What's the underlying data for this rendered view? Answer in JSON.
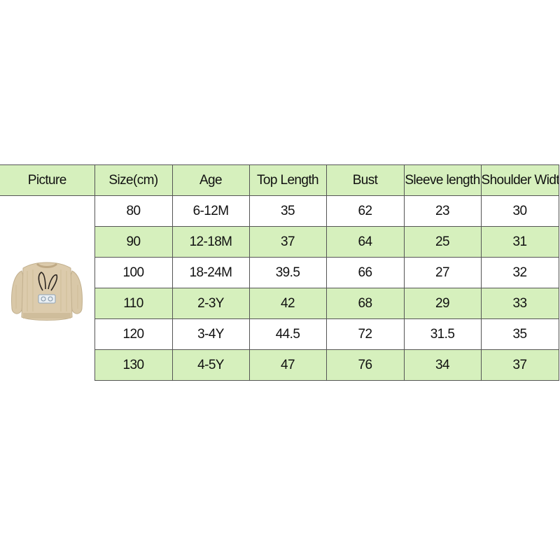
{
  "table": {
    "headers": [
      "Picture",
      "Size(cm)",
      "Age",
      "Top Length",
      "Bust",
      "Sleeve length",
      "Shoulder Width"
    ],
    "rows": [
      {
        "size": "80",
        "age": "6-12M",
        "top_length": "35",
        "bust": "62",
        "sleeve_length": "23",
        "shoulder_width": "30"
      },
      {
        "size": "90",
        "age": "12-18M",
        "top_length": "37",
        "bust": "64",
        "sleeve_length": "25",
        "shoulder_width": "31"
      },
      {
        "size": "100",
        "age": "18-24M",
        "top_length": "39.5",
        "bust": "66",
        "sleeve_length": "27",
        "shoulder_width": "32"
      },
      {
        "size": "110",
        "age": "2-3Y",
        "top_length": "42",
        "bust": "68",
        "sleeve_length": "29",
        "shoulder_width": "33"
      },
      {
        "size": "120",
        "age": "3-4Y",
        "top_length": "44.5",
        "bust": "72",
        "sleeve_length": "31.5",
        "shoulder_width": "35"
      },
      {
        "size": "130",
        "age": "4-5Y",
        "top_length": "47",
        "bust": "76",
        "sleeve_length": "34",
        "shoulder_width": "37"
      }
    ]
  },
  "colors": {
    "header_fill": "#d6f0bd",
    "stripe_fill": "#d6f0bd",
    "plain_fill": "#ffffff",
    "border": "#555555",
    "sweater": "#d9c8a8"
  },
  "picture": {
    "icon": "bunny-sweater-icon"
  }
}
